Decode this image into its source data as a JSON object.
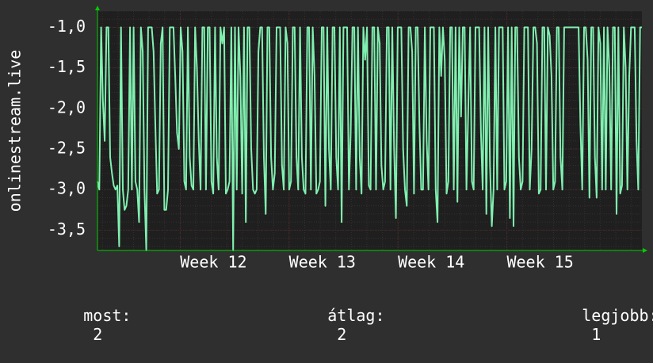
{
  "chart_data": {
    "type": "line",
    "ylabel": "onlinestream.live",
    "ylim": [
      -3.75,
      -0.8
    ],
    "ytick_values": [
      -1.0,
      -1.5,
      -2.0,
      -2.5,
      -3.0,
      -3.5
    ],
    "ytick_labels": [
      "-1,0",
      "-1,5",
      "-2,0",
      "-2,5",
      "-3,0",
      "-3,5"
    ],
    "xlim": [
      0,
      1000
    ],
    "xtick_positions": [
      152,
      352,
      552,
      752
    ],
    "xtick_labels": [
      "Week 12",
      "Week 13",
      "Week 14",
      "Week 15"
    ],
    "grid": true,
    "colors": {
      "background": "#2f2f2f",
      "plot_background": "#1f1f1f",
      "grid": "#4a2a2a",
      "line": "#80f0b0",
      "axis": "#00cc00"
    },
    "series": [
      {
        "values": [
          -2.9,
          -3.0,
          -1.0,
          -1.9,
          -2.4,
          -1.0,
          -1.0,
          -2.6,
          -2.8,
          -2.95,
          -3.0,
          -2.95,
          -3.7,
          -1.0,
          -3.0,
          -3.25,
          -3.2,
          -3.0,
          -1.0,
          -3.0,
          -1.0,
          -2.9,
          -3.0,
          -3.4,
          -1.0,
          -1.3,
          -3.0,
          -3.75,
          -1.0,
          -1.0,
          -1.0,
          -1.3,
          -2.2,
          -3.05,
          -3.0,
          -1.2,
          -1.0,
          -3.25,
          -3.25,
          -3.0,
          -1.0,
          -1.0,
          -1.0,
          -1.6,
          -2.3,
          -2.5,
          -1.0,
          -1.3,
          -2.9,
          -3.0,
          -1.0,
          -2.6,
          -2.95,
          -3.0,
          -1.0,
          -1.5,
          -2.4,
          -3.0,
          -1.0,
          -1.0,
          -3.0,
          -1.0,
          -1.0,
          -2.9,
          -3.05,
          -1.0,
          -2.6,
          -3.0,
          -1.0,
          -1.2,
          -1.0,
          -3.05,
          -3.0,
          -2.9,
          -1.0,
          -3.75,
          -1.0,
          -3.0,
          -1.0,
          -1.6,
          -3.05,
          -1.0,
          -3.4,
          -1.0,
          -1.0,
          -2.5,
          -3.0,
          -3.05,
          -3.0,
          -1.3,
          -1.0,
          -1.0,
          -2.6,
          -3.3,
          -1.0,
          -1.0,
          -2.6,
          -3.0,
          -2.8,
          -1.0,
          -1.0,
          -1.0,
          -2.7,
          -3.0,
          -1.0,
          -1.2,
          -3.0,
          -2.9,
          -1.0,
          -1.0,
          -2.6,
          -3.0,
          -1.0,
          -2.6,
          -3.0,
          -3.05,
          -1.0,
          -1.0,
          -3.0,
          -1.0,
          -1.6,
          -3.05,
          -3.0,
          -2.9,
          -1.0,
          -1.0,
          -3.2,
          -1.0,
          -2.5,
          -3.0,
          -1.0,
          -1.0,
          -2.6,
          -3.0,
          -1.0,
          -3.4,
          -1.0,
          -1.0,
          -1.0,
          -3.0,
          -2.3,
          -1.0,
          -1.0,
          -3.0,
          -1.0,
          -2.6,
          -3.05,
          -1.0,
          -1.4,
          -1.0,
          -2.95,
          -3.0,
          -1.0,
          -1.0,
          -3.0,
          -1.0,
          -1.2,
          -2.7,
          -3.0,
          -2.9,
          -1.0,
          -1.0,
          -3.0,
          -1.0,
          -2.5,
          -3.35,
          -1.0,
          -1.0,
          -1.0,
          -2.5,
          -3.0,
          -3.2,
          -1.0,
          -1.0,
          -1.3,
          -3.05,
          -1.0,
          -1.0,
          -2.2,
          -3.0,
          -3.0,
          -1.0,
          -2.4,
          -3.0,
          -1.0,
          -1.0,
          -1.0,
          -3.0,
          -3.4,
          -1.0,
          -1.6,
          -1.0,
          -1.4,
          -3.05,
          -2.9,
          -1.0,
          -1.0,
          -3.0,
          -1.0,
          -3.15,
          -1.0,
          -2.1,
          -1.0,
          -1.0,
          -3.0,
          -2.0,
          -1.0,
          -2.9,
          -3.0,
          -1.0,
          -1.0,
          -1.0,
          -2.3,
          -3.0,
          -1.0,
          -3.3,
          -1.0,
          -2.7,
          -3.45,
          -3.0,
          -1.0,
          -3.0,
          -1.0,
          -1.0,
          -1.0,
          -3.0,
          -2.9,
          -1.0,
          -3.35,
          -1.0,
          -3.45,
          -1.0,
          -1.0,
          -2.6,
          -3.0,
          -2.9,
          -1.0,
          -1.0,
          -1.0,
          -3.0,
          -2.5,
          -1.0,
          -1.0,
          -1.2,
          -3.05,
          -3.0,
          -1.0,
          -1.0,
          -3.0,
          -1.0,
          -1.1,
          -1.6,
          -3.0,
          -2.9,
          -1.0,
          -1.0,
          -2.6,
          -3.0,
          -1.0,
          -1.0,
          -1.0,
          -1.0,
          -1.0,
          -1.0,
          -1.0,
          -1.0,
          -1.0,
          -2.2,
          -3.0,
          -1.0,
          -1.0,
          -1.4,
          -3.1,
          -1.0,
          -1.0,
          -2.6,
          -3.1,
          -1.0,
          -1.2,
          -3.0,
          -1.0,
          -3.0,
          -1.0,
          -1.5,
          -3.0,
          -1.0,
          -1.0,
          -3.3,
          -1.0,
          -3.05,
          -2.95,
          -1.0,
          -1.5,
          -3.0,
          -1.6,
          -1.0,
          -1.0,
          -1.0,
          -2.4,
          -3.0,
          -1.0,
          -1.0
        ]
      }
    ]
  },
  "summary": {
    "now_label": "most:",
    "now_value": "2",
    "avg_label": "átlag:",
    "avg_value": "2",
    "best_label": "legjobb:",
    "best_value": "1"
  }
}
